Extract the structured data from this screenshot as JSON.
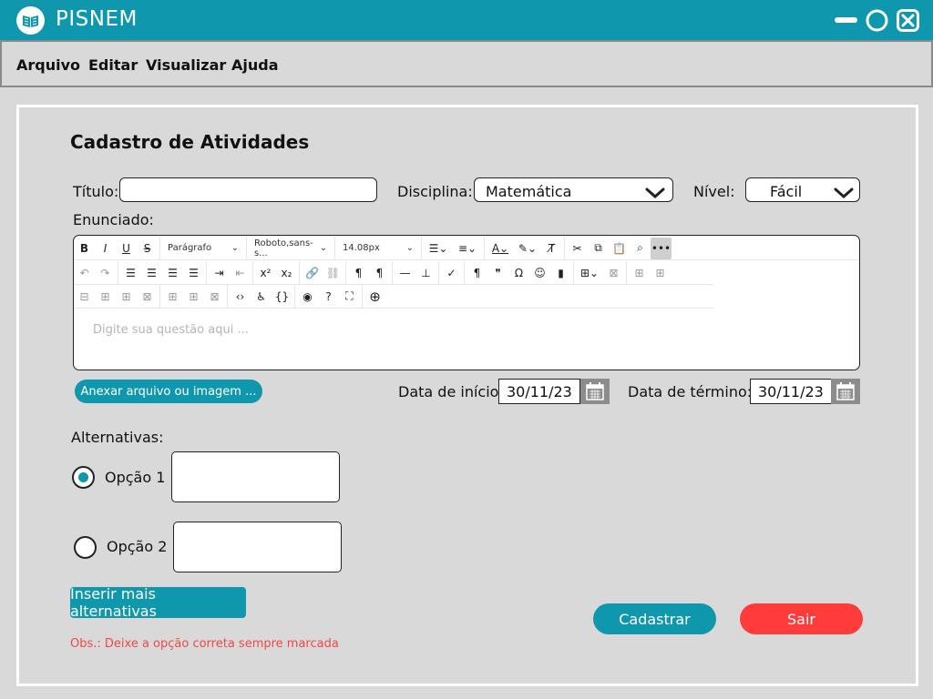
{
  "app": {
    "title": "PISNEM",
    "logo_icon": "book-icon"
  },
  "window_controls": [
    "minimize-icon",
    "maximize-icon",
    "close-icon"
  ],
  "menu": [
    "Arquivo",
    "Editar",
    "Visualizar",
    "Ajuda"
  ],
  "form": {
    "title": "Cadastro de Atividades",
    "titulo_label": "Título:",
    "titulo_value": "",
    "disciplina_label": "Disciplina:",
    "disciplina_value": "Matemática",
    "nivel_label": "Nível:",
    "nivel_value": "Fácil",
    "enunciado_label": "Enunciado:"
  },
  "editor": {
    "placeholder": "Digite sua questão aqui ...",
    "format_block": "Parágrafo",
    "font_family": "Roboto,sans-s...",
    "font_size": "14.08px"
  },
  "attach_button": "Anexar arquivo ou imagem ...",
  "dates": {
    "start_label": "Data de início:",
    "start_value": "30/11/23",
    "end_label": "Data de término:",
    "end_value": "30/11/23"
  },
  "alternatives": {
    "label": "Alternativas:",
    "options": [
      {
        "label": "Opção 1",
        "selected": true
      },
      {
        "label": "Opção 2",
        "selected": false
      }
    ],
    "add_button": "Inserir mais alternativas"
  },
  "note": "Obs.: Deixe a opção correta sempre marcada",
  "actions": {
    "save": "Cadastrar",
    "exit": "Sair"
  },
  "colors": {
    "accent": "#0f97ad",
    "danger": "#ff3b3b",
    "note": "#f04848",
    "background": "#d9d9d9"
  }
}
